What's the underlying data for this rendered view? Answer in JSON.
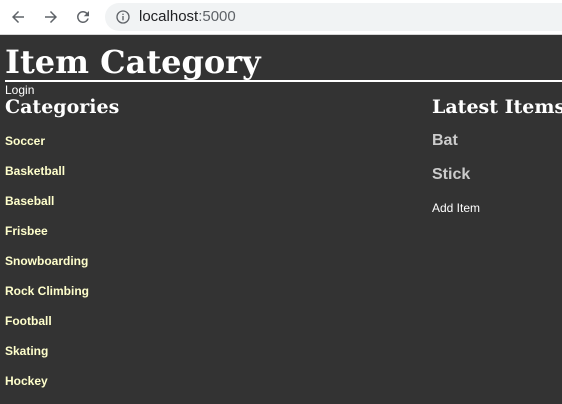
{
  "browser": {
    "url_host": "localhost",
    "url_port": ":5000",
    "icons": [
      "back-arrow-icon",
      "forward-arrow-icon",
      "reload-icon",
      "info-icon"
    ]
  },
  "page": {
    "title": "Item Category",
    "login_label": "Login"
  },
  "categories": {
    "heading": "Categories",
    "items": [
      "Soccer",
      "Basketball",
      "Baseball",
      "Frisbee",
      "Snowboarding",
      "Rock Climbing",
      "Football",
      "Skating",
      "Hockey"
    ]
  },
  "latest": {
    "heading": "Latest Items",
    "items": [
      "Bat",
      "Stick"
    ],
    "add_label": "Add Item"
  },
  "colors": {
    "page_background": "#333333",
    "category_link": "#ffffcc",
    "latest_item": "#cccccc",
    "text": "#ffffff"
  }
}
